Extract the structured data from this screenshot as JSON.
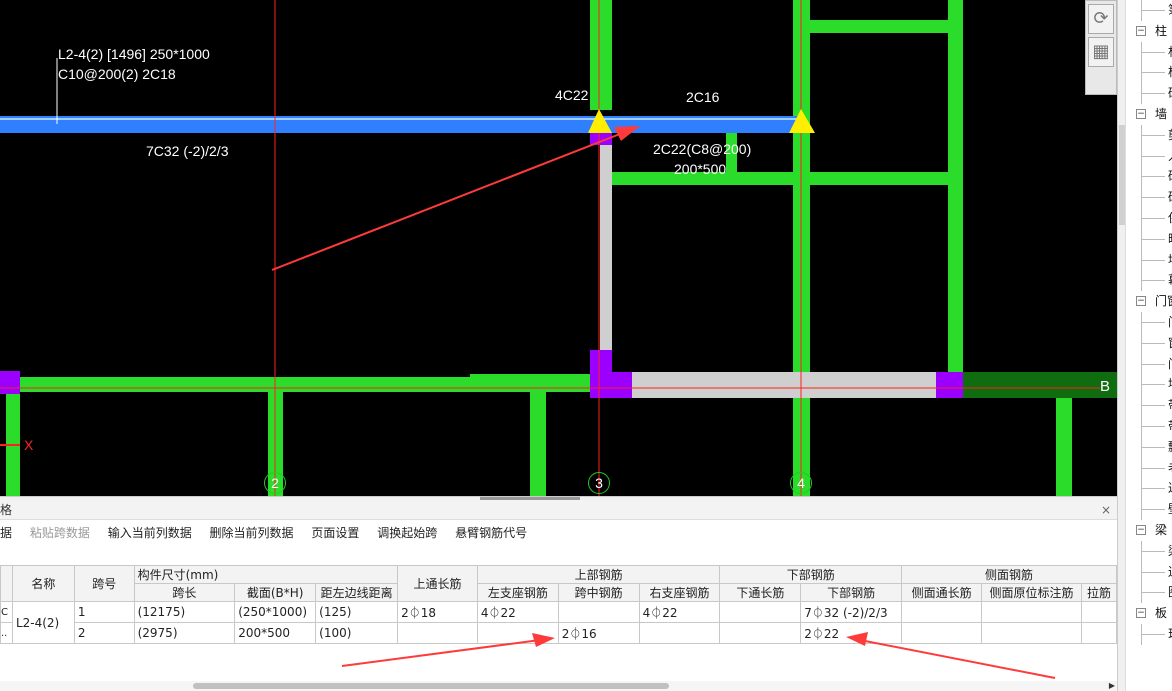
{
  "canvas": {
    "beam_annotation_line1": "L2-4(2) [1496] 250*1000",
    "beam_annotation_line2": "C10@200(2) 2C18",
    "left_support_label": "4C22",
    "mid_top_label": "2C16",
    "bottom_label": "7C32 (-2)/2/3",
    "span2_label_line1": "2C22(C8@200)",
    "span2_label_line2": "200*500",
    "axis_2": "2",
    "axis_3": "3",
    "axis_4": "4",
    "axis_b": "B",
    "x_axis_marker": "X"
  },
  "panel": {
    "title": "格",
    "close": "×",
    "toolbar": {
      "item0": "据",
      "item1": "粘贴跨数据",
      "item2": "输入当前列数据",
      "item3": "删除当前列数据",
      "item4": "页面设置",
      "item5": "调换起始跨",
      "item6": "悬臂钢筋代号"
    }
  },
  "table": {
    "headers": {
      "name": "名称",
      "span_no": "跨号",
      "size_group": "构件尺寸(mm)",
      "span_len": "跨长",
      "section": "截面(B*H)",
      "dist_left": "距左边线距离",
      "top_through": "上通长筋",
      "top_group": "上部钢筋",
      "left_support": "左支座钢筋",
      "mid_span": "跨中钢筋",
      "right_support": "右支座钢筋",
      "bottom_group": "下部钢筋",
      "bottom_through": "下通长筋",
      "bottom_bars": "下部钢筋",
      "side_group": "侧面钢筋",
      "side_through": "侧面通长筋",
      "side_original": "侧面原位标注筋",
      "tie": "拉筋"
    },
    "row_marker_1": "C",
    "row_marker_2": "..",
    "name_value": "L2-4(2)",
    "rows": [
      {
        "span_no": "1",
        "span_len": "(12175)",
        "section": "(250*1000)",
        "dist_left": "(125)",
        "top_through": "2⏀18",
        "left_support": "4⏀22",
        "mid_span": "",
        "right_support": "4⏀22",
        "bottom_through": "",
        "bottom_bars": "7⏀32 (-2)/2/3",
        "side_through": "",
        "side_original": "",
        "tie": ""
      },
      {
        "span_no": "2",
        "span_len": "(2975)",
        "section": "200*500",
        "dist_left": "(100)",
        "top_through": "",
        "left_support": "",
        "mid_span": "2⏀16",
        "right_support": "",
        "bottom_through": "",
        "bottom_bars": "2⏀22",
        "side_through": "",
        "side_original": "",
        "tie": ""
      }
    ]
  },
  "tree": {
    "items": [
      {
        "type": "leaf",
        "label": "箓"
      },
      {
        "type": "group",
        "label": "柱"
      },
      {
        "type": "leaf",
        "label": "杜"
      },
      {
        "type": "leaf",
        "label": "构"
      },
      {
        "type": "leaf",
        "label": "砧"
      },
      {
        "type": "group",
        "label": "墙"
      },
      {
        "type": "leaf",
        "label": "剪"
      },
      {
        "type": "leaf",
        "label": "人"
      },
      {
        "type": "leaf",
        "label": "砧"
      },
      {
        "type": "leaf",
        "label": "砧"
      },
      {
        "type": "leaf",
        "label": "保"
      },
      {
        "type": "leaf",
        "label": "暗"
      },
      {
        "type": "leaf",
        "label": "墙"
      },
      {
        "type": "leaf",
        "label": "幕"
      },
      {
        "type": "group",
        "label": "门窗"
      },
      {
        "type": "leaf",
        "label": "门"
      },
      {
        "type": "leaf",
        "label": "窗"
      },
      {
        "type": "leaf",
        "label": "门"
      },
      {
        "type": "leaf",
        "label": "墙"
      },
      {
        "type": "leaf",
        "label": "带"
      },
      {
        "type": "leaf",
        "label": "带"
      },
      {
        "type": "leaf",
        "label": "飘"
      },
      {
        "type": "leaf",
        "label": "老"
      },
      {
        "type": "leaf",
        "label": "过"
      },
      {
        "type": "leaf",
        "label": "壁"
      },
      {
        "type": "group",
        "label": "梁"
      },
      {
        "type": "leaf",
        "label": "梁"
      },
      {
        "type": "leaf",
        "label": "连"
      },
      {
        "type": "leaf",
        "label": "圈"
      },
      {
        "type": "group",
        "label": "板"
      },
      {
        "type": "leaf",
        "label": "现"
      }
    ]
  },
  "colors": {
    "canvas_bg": "#000000",
    "beam_selected": "#2f7fff",
    "wall_green": "#2bdc2b",
    "column_purple": "#9b00ff",
    "axis_red": "#ff2020",
    "grey_beam": "#cfcfcf",
    "marker_yellow": "#ffee00"
  }
}
